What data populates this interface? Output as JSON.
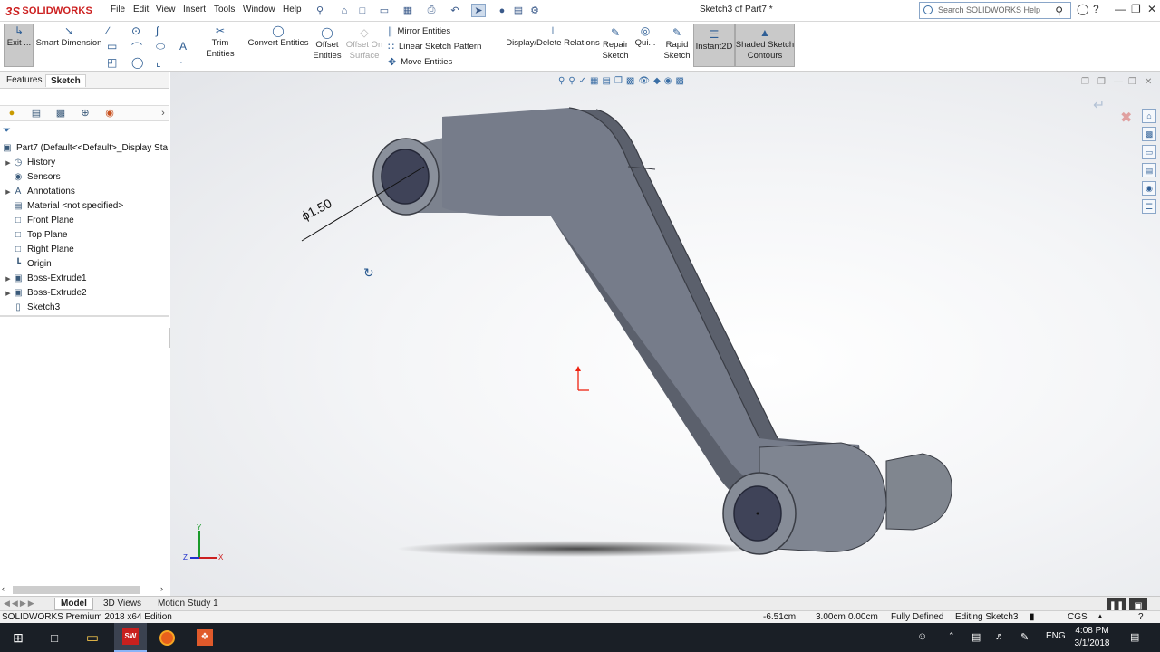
{
  "app": {
    "logo_text": "SOLIDWORKS",
    "logo_ds": "3S",
    "doc_title": "Sketch3 of Part7 *"
  },
  "menus": [
    "File",
    "Edit",
    "View",
    "Insert",
    "Tools",
    "Window",
    "Help"
  ],
  "search": {
    "placeholder": "Search SOLIDWORKS Help"
  },
  "command_manager": {
    "exit_sketch": "Exit ...",
    "smart_dimension": "Smart Dimension",
    "trim_entities": "Trim Entities",
    "convert_entities": "Convert Entities",
    "offset_entities_1": "Offset",
    "offset_entities_2": "Entities",
    "offset_surface_1": "Offset On",
    "offset_surface_2": "Surface",
    "mirror_entities": "Mirror Entities",
    "linear_sketch_pattern": "Linear Sketch Pattern",
    "move_entities": "Move Entities",
    "display_delete_relations": "Display/Delete Relations",
    "repair_sketch_1": "Repair",
    "repair_sketch_2": "Sketch",
    "quick_snaps": "Qui...",
    "rapid_sketch_1": "Rapid",
    "rapid_sketch_2": "Sketch",
    "instant2d": "Instant2D",
    "shaded_contours_1": "Shaded Sketch",
    "shaded_contours_2": "Contours"
  },
  "left_panel": {
    "tabs": [
      "Features",
      "Sketch"
    ],
    "active_tab": "Sketch",
    "tree": [
      {
        "label": "Part7  (Default<<Default>_Display Sta",
        "icon": "part-icon",
        "expand": false
      },
      {
        "label": "History",
        "icon": "history-icon",
        "expand": true
      },
      {
        "label": "Sensors",
        "icon": "sensors-icon",
        "expand": false
      },
      {
        "label": "Annotations",
        "icon": "annotations-icon",
        "expand": true
      },
      {
        "label": "Material <not specified>",
        "icon": "material-icon",
        "expand": false
      },
      {
        "label": "Front Plane",
        "icon": "plane-icon",
        "expand": false
      },
      {
        "label": "Top Plane",
        "icon": "plane-icon",
        "expand": false
      },
      {
        "label": "Right Plane",
        "icon": "plane-icon",
        "expand": false
      },
      {
        "label": "Origin",
        "icon": "origin-icon",
        "expand": false
      },
      {
        "label": "Boss-Extrude1",
        "icon": "extrude-icon",
        "expand": true
      },
      {
        "label": "Boss-Extrude2",
        "icon": "extrude-icon",
        "expand": true
      },
      {
        "label": "Sketch3",
        "icon": "sketch-icon",
        "expand": false
      }
    ]
  },
  "viewport": {
    "dimension_text": "ϕ1.50"
  },
  "bottom_tabs": [
    "Model",
    "3D Views",
    "Motion Study 1"
  ],
  "status": {
    "edition": "SOLIDWORKS Premium 2018 x64 Edition",
    "x": "-6.51cm",
    "y": "3.00cm",
    "z": "0.00cm",
    "state": "Fully Defined",
    "editing": "Editing Sketch3",
    "units": "CGS"
  },
  "taskbar": {
    "time": "4:08 PM",
    "date": "3/1/2018",
    "lang": "ENG"
  },
  "colors": {
    "brand_red": "#cc1f1f",
    "part_face": "#7e8493",
    "part_dark": "#535864",
    "selection_blue": "#2f5f96"
  }
}
